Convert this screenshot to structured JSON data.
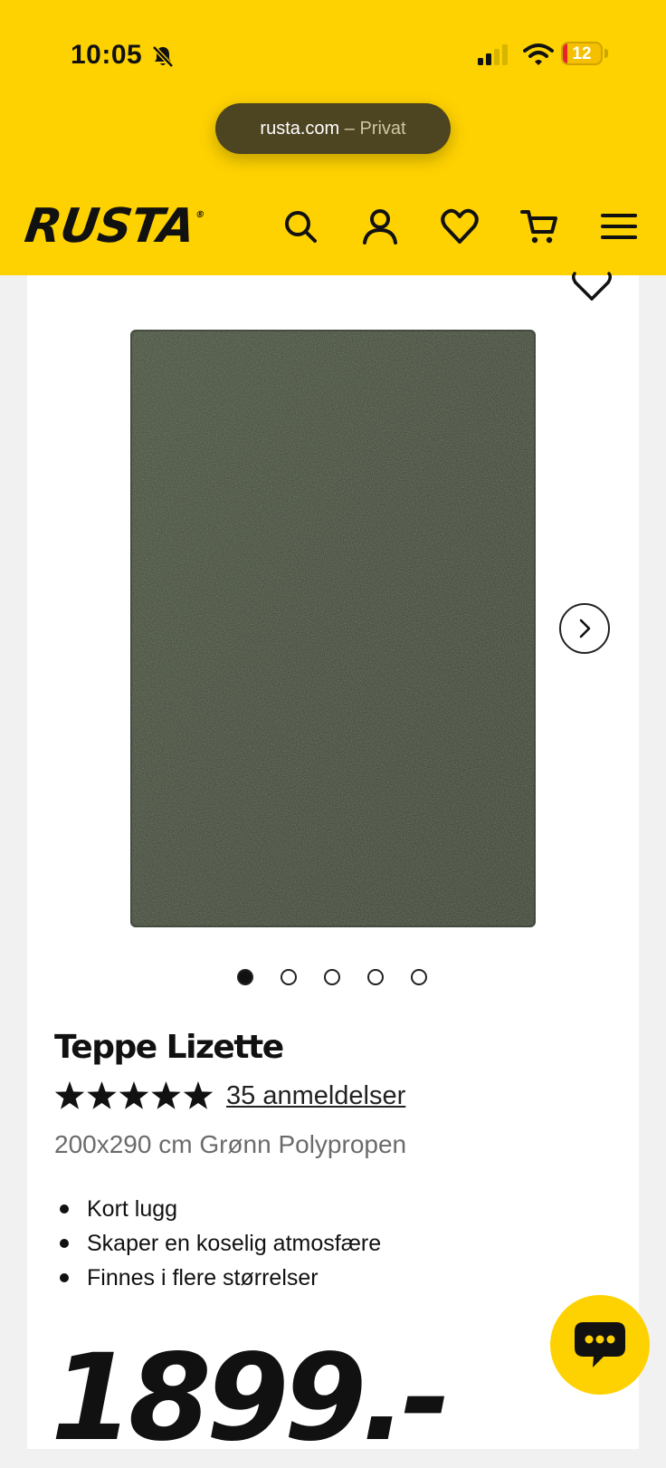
{
  "status_bar": {
    "time": "10:05",
    "battery_level": "12",
    "battery_fraction": 0.12,
    "icons": [
      "bell-slash-icon",
      "signal-icon",
      "wifi-icon",
      "battery-icon"
    ]
  },
  "browser": {
    "domain": "rusta.com",
    "mode": "– Privat"
  },
  "header": {
    "logo": "RUSTA",
    "logo_mark": "®",
    "icons": [
      "search-icon",
      "account-icon",
      "heart-icon",
      "cart-icon",
      "menu-icon"
    ]
  },
  "colors": {
    "brand_yellow": "#fed200",
    "text": "#111111",
    "muted": "#6b6b6b",
    "rug_green": "#4c5443"
  },
  "product": {
    "image": "rug-image",
    "gallery_count": 5,
    "gallery_active": 1,
    "title": "Teppe Lizette",
    "rating": 5,
    "rating_max": 5,
    "reviews": "35 anmeldelser",
    "variant": "200x290 cm Grønn Polypropen",
    "features": [
      "Kort lugg",
      "Skaper en koselig atmosfære",
      "Finnes i flere størrelser"
    ],
    "price": "1899.-"
  },
  "chat": {
    "icon": "chat-icon"
  }
}
